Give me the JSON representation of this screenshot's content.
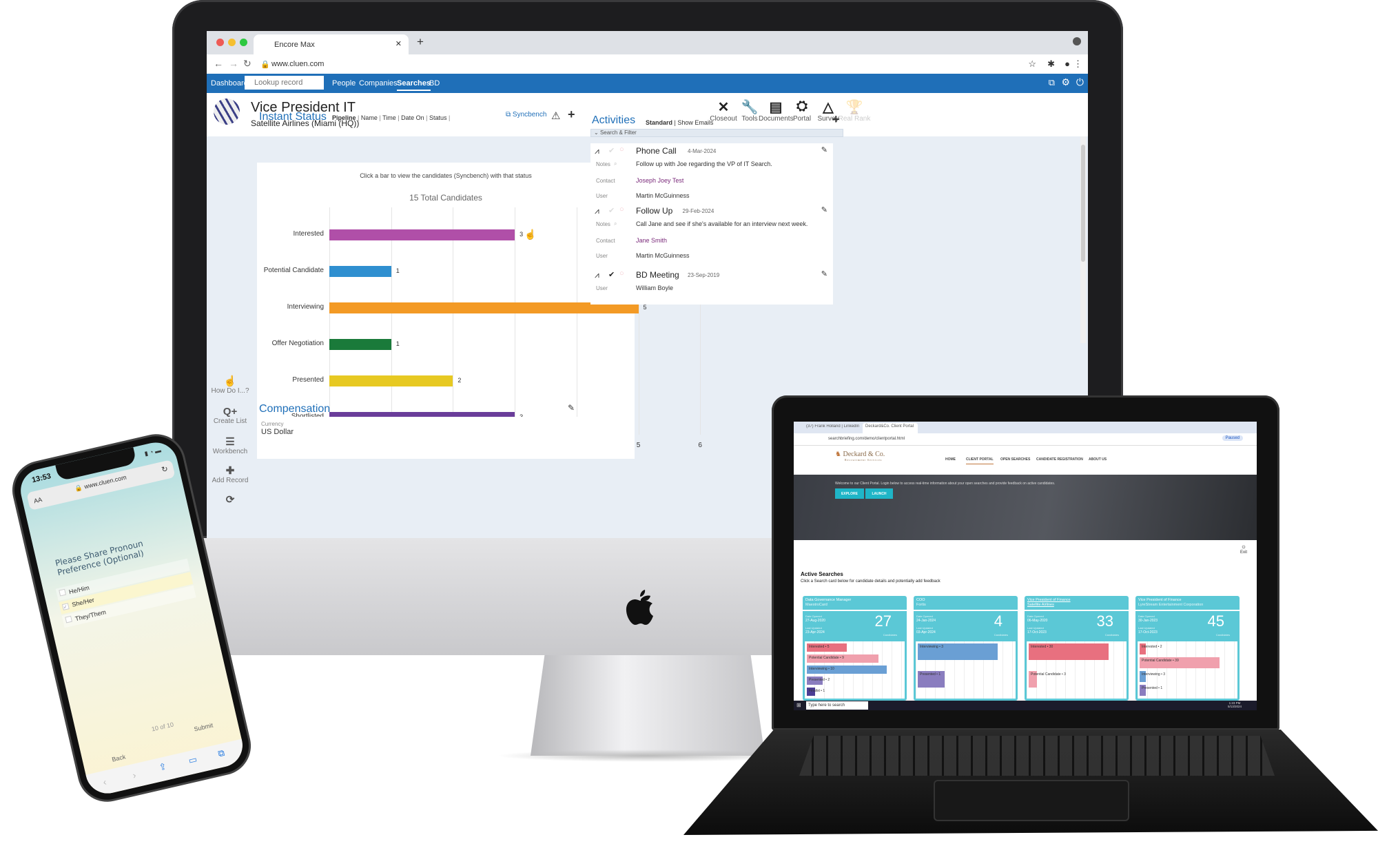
{
  "imac": {
    "browser": {
      "tab_title": "Encore Max",
      "url": "www.cluen.com"
    },
    "nav": {
      "dashboard": "Dashboard",
      "lookup_placeholder": "Lookup record",
      "items": [
        "People",
        "Companies",
        "Searches",
        "BD"
      ],
      "active": "Searches"
    },
    "header": {
      "title": "Vice President IT",
      "subtitle": "Satellite Airlines (Miami (HQ))",
      "actions": [
        {
          "label": "Closeout",
          "icon": "close-icon",
          "glyph": "✕"
        },
        {
          "label": "Tools",
          "icon": "wrench-icon",
          "glyph": "🔧"
        },
        {
          "label": "Documents",
          "icon": "document-icon",
          "glyph": "▤"
        },
        {
          "label": "Portal",
          "icon": "portal-icon",
          "glyph": "⛭"
        },
        {
          "label": "Survey",
          "icon": "survey-icon",
          "glyph": "△"
        },
        {
          "label": "Real Rank",
          "icon": "trophy-icon",
          "glyph": "🏆",
          "disabled": true
        }
      ]
    },
    "sidebar": [
      {
        "label": "How Do I...?",
        "glyph": "☝"
      },
      {
        "label": "Create List",
        "glyph": "Q+"
      },
      {
        "label": "Workbench",
        "glyph": "☰"
      },
      {
        "label": "Add Record",
        "glyph": "✚"
      },
      {
        "label": "",
        "glyph": "⟳"
      }
    ],
    "instant_status": {
      "title": "Instant Status",
      "tabs": [
        "Pipeline",
        "Name",
        "Time",
        "Date On",
        "Status"
      ],
      "active_tab": "Pipeline",
      "syncbench": "Syncbench",
      "hint": "Click a bar to view the candidates (Syncbench) with that status",
      "total": "15 Total Candidates"
    },
    "chart_data": {
      "type": "bar",
      "orientation": "horizontal",
      "categories": [
        "Interested",
        "Potential Candidate",
        "Interviewing",
        "Offer Negotiation",
        "Presented",
        "Shortlisted"
      ],
      "values": [
        3,
        1,
        5,
        1,
        2,
        3
      ],
      "colors": [
        "#b04fa8",
        "#2f8fd0",
        "#f39a25",
        "#1a7a3a",
        "#e7c922",
        "#6a3d9a"
      ],
      "xlim": [
        0,
        6
      ],
      "xticks": [
        0,
        1,
        2,
        3,
        4,
        5,
        6
      ],
      "grid": true
    },
    "compensation": {
      "title": "Compensation",
      "currency_label": "Currency",
      "currency_value": "US Dollar"
    },
    "activities": {
      "title": "Activities",
      "views": [
        "Standard",
        "Show Emails"
      ],
      "filter": "Search & Filter",
      "items": [
        {
          "type": "Phone Call",
          "date": "4-Mar-2024",
          "done": false,
          "rows": [
            [
              "Notes",
              "Follow up with Joe regarding the VP of IT Search."
            ],
            [
              "Contact",
              "Joseph Joey Test"
            ],
            [
              "User",
              "Martin McGuinness"
            ]
          ]
        },
        {
          "type": "Follow Up",
          "date": "29-Feb-2024",
          "done": false,
          "rows": [
            [
              "Notes",
              "Call Jane and see if she's available for an interview next week."
            ],
            [
              "Contact",
              "Jane Smith"
            ],
            [
              "User",
              "Martin McGuinness"
            ]
          ]
        },
        {
          "type": "BD Meeting",
          "date": "23-Sep-2019",
          "done": true,
          "rows": [
            [
              "User",
              "William Boyle"
            ]
          ]
        }
      ]
    }
  },
  "laptop": {
    "tabs": [
      "(37) Frank Holland | LinkedIn",
      "Deckard&Co. Client Portal"
    ],
    "url": "searchbriefing.com/demo/clientportal.html",
    "profile": "Paused",
    "brand": "Deckard & Co.",
    "brand_sub": "Recruitment Services",
    "menu": [
      "HOME",
      "CLIENT PORTAL",
      "OPEN SEARCHES",
      "CANDIDATE REGISTRATION",
      "ABOUT US"
    ],
    "menu_active": "CLIENT PORTAL",
    "hero_text": "Welcome to our Client Portal. Login below to access real-time information about your open searches and provide feedback on active candidates.",
    "buttons": [
      "EXPLORE",
      "LAUNCH"
    ],
    "exit": "Exit",
    "section_title": "Active Searches",
    "section_sub": "Click a Search card below for candidate details and potentially add feedback",
    "date_opened_label": "Date Opened",
    "last_updated_label": "Last Updated",
    "candidates_label": "Candidates",
    "bar_colors": {
      "Interested": "#e8707f",
      "Potential Candidate": "#f0a0ad",
      "Interviewing": "#6a9fd4",
      "Presented": "#8a7dbf",
      "Finalist": "#4b3d94"
    },
    "cards": [
      {
        "title": "Data Governance Manager",
        "company": "MaestroCard",
        "opened": "27-Aug-2020",
        "updated": "23-Apr-2024",
        "count": "27",
        "bars": [
          [
            "Interested",
            5
          ],
          [
            "Potential Candidate",
            9
          ],
          [
            "Interviewing",
            10
          ],
          [
            "Presented",
            2
          ],
          [
            "Finalist",
            1
          ]
        ]
      },
      {
        "title": "COO",
        "company": "Fortis",
        "opened": "24-Jan-2024",
        "updated": "03-Apr-2024",
        "count": "4",
        "bars": [
          [
            "Interviewing",
            3
          ],
          [
            "Presented",
            1
          ]
        ]
      },
      {
        "title": "Vice President of Finance",
        "company": "Satellite Airlines",
        "opened": "06-May-2020",
        "updated": "17-Oct-2023",
        "count": "33",
        "link": true,
        "bars": [
          [
            "Interested",
            30
          ],
          [
            "Potential Candidate",
            3
          ]
        ]
      },
      {
        "title": "Vice President of Finance",
        "company": "LyreStream Entertainment Corporation",
        "opened": "30-Jan-2023",
        "updated": "17-Oct-2023",
        "count": "45",
        "bars": [
          [
            "Interested",
            2
          ],
          [
            "Potential Candidate",
            39
          ],
          [
            "Interviewing",
            3
          ],
          [
            "Presented",
            1
          ]
        ]
      }
    ],
    "taskbar": {
      "search_placeholder": "Type here to search",
      "time": "1:23 PM",
      "date": "5/13/2024"
    }
  },
  "phone": {
    "time": "13:53",
    "aa": "AA",
    "url": "www.cluen.com",
    "question": "Please Share Pronoun Preference (Optional)",
    "options": [
      {
        "label": "He/Him",
        "checked": false
      },
      {
        "label": "She/Her",
        "checked": true
      },
      {
        "label": "They/Them",
        "checked": false
      }
    ],
    "progress": "10 of 10",
    "back": "Back",
    "submit": "Submit"
  }
}
